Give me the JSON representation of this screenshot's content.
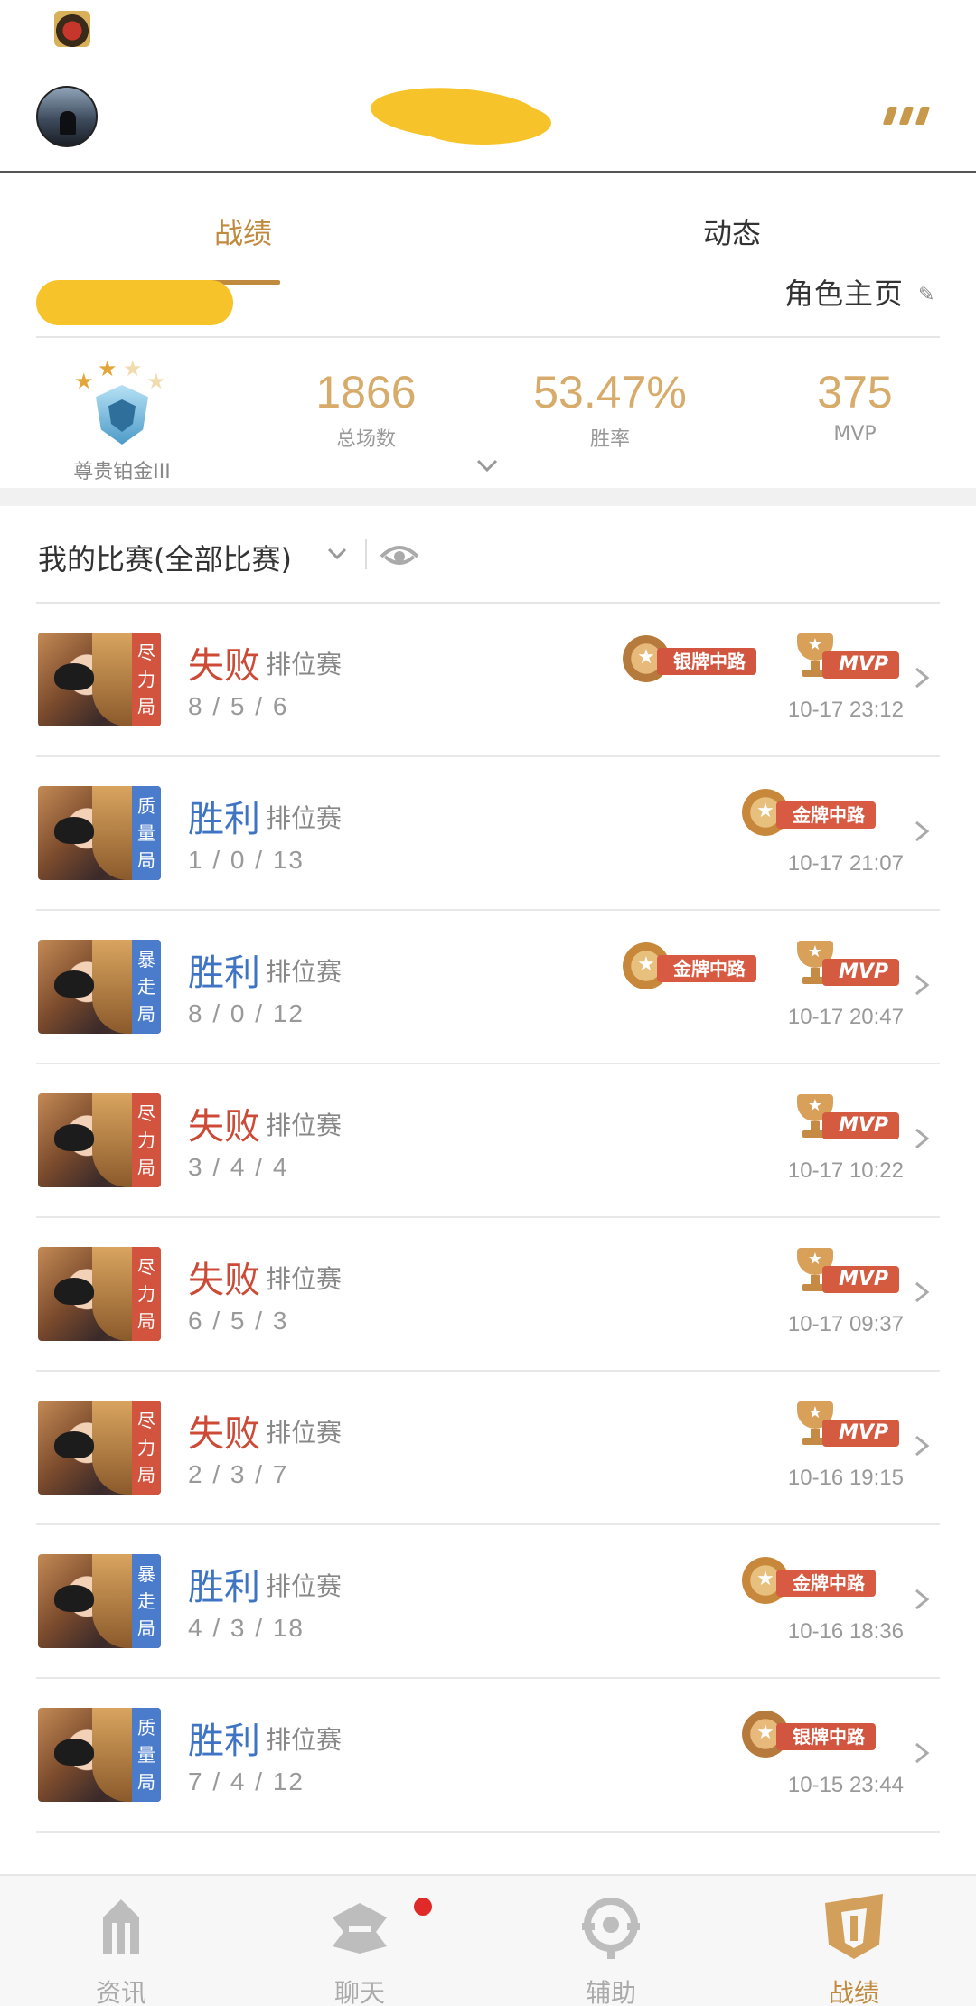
{
  "header": {
    "title_masked": true
  },
  "tabs": [
    {
      "label": "战绩",
      "active": true
    },
    {
      "label": "动态",
      "active": false
    }
  ],
  "role": {
    "label": "角色主页"
  },
  "profile": {
    "rank": "尊贵铂金III",
    "stars_filled": 3,
    "stars_total": 5,
    "stats": [
      {
        "value": "1866",
        "label": "总场数"
      },
      {
        "value": "53.47%",
        "label": "胜率"
      },
      {
        "value": "375",
        "label": "MVP"
      }
    ]
  },
  "filter": {
    "title": "我的比赛(全部比赛)"
  },
  "matches": [
    {
      "tag": "尽力局",
      "tag_type": "lose",
      "result": "失败",
      "result_type": "lose",
      "mode": "排位赛",
      "kda": "8 / 5 / 6",
      "lane_badge": "银牌中路",
      "mvp_badge": "MVP",
      "time": "10-17 23:12"
    },
    {
      "tag": "质量局",
      "tag_type": "win",
      "result": "胜利",
      "result_type": "win",
      "mode": "排位赛",
      "kda": "1 / 0 / 13",
      "lane_badge": "金牌中路",
      "mvp_badge": "",
      "time": "10-17 21:07"
    },
    {
      "tag": "暴走局",
      "tag_type": "win",
      "result": "胜利",
      "result_type": "win",
      "mode": "排位赛",
      "kda": "8 / 0 / 12",
      "lane_badge": "金牌中路",
      "mvp_badge": "MVP",
      "time": "10-17 20:47"
    },
    {
      "tag": "尽力局",
      "tag_type": "lose",
      "result": "失败",
      "result_type": "lose",
      "mode": "排位赛",
      "kda": "3 / 4 / 4",
      "lane_badge": "",
      "mvp_badge": "MVP",
      "time": "10-17 10:22"
    },
    {
      "tag": "尽力局",
      "tag_type": "lose",
      "result": "失败",
      "result_type": "lose",
      "mode": "排位赛",
      "kda": "6 / 5 / 3",
      "lane_badge": "",
      "mvp_badge": "MVP",
      "time": "10-17 09:37"
    },
    {
      "tag": "尽力局",
      "tag_type": "lose",
      "result": "失败",
      "result_type": "lose",
      "mode": "排位赛",
      "kda": "2 / 3 / 7",
      "lane_badge": "",
      "mvp_badge": "MVP",
      "time": "10-16 19:15"
    },
    {
      "tag": "暴走局",
      "tag_type": "win",
      "result": "胜利",
      "result_type": "win",
      "mode": "排位赛",
      "kda": "4 / 3 / 18",
      "lane_badge": "金牌中路",
      "mvp_badge": "",
      "time": "10-16 18:36"
    },
    {
      "tag": "质量局",
      "tag_type": "win",
      "result": "胜利",
      "result_type": "win",
      "mode": "排位赛",
      "kda": "7 / 4 / 12",
      "lane_badge": "银牌中路",
      "mvp_badge": "",
      "time": "10-15 23:44"
    }
  ],
  "bottom_nav": [
    {
      "label": "资讯",
      "icon": "news-icon",
      "active": false
    },
    {
      "label": "聊天",
      "icon": "chat-icon",
      "active": false,
      "badge_dot": true
    },
    {
      "label": "辅助",
      "icon": "assist-icon",
      "active": false
    },
    {
      "label": "战绩",
      "icon": "record-icon",
      "active": true
    }
  ],
  "colors": {
    "accent": "#c08b3e",
    "lose": "#cc4a36",
    "win": "#3f74c4",
    "stat_value": "#d7ab6a"
  }
}
